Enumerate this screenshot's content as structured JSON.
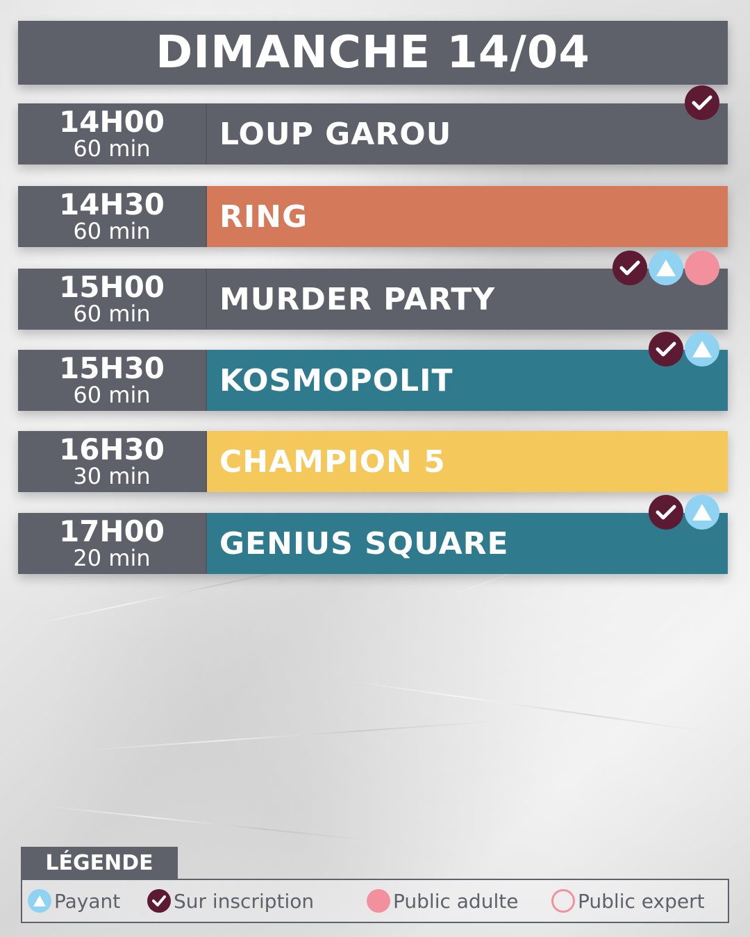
{
  "header": {
    "title": "DIMANCHE 14/04"
  },
  "colors": {
    "slate": "#5e616a",
    "orange": "#d4795a",
    "teal": "#2f7b8d",
    "yellow": "#f5c85c",
    "maroon": "#5c1b33",
    "light_blue": "#8fd2f2",
    "pink": "#f3909e"
  },
  "schedule": [
    {
      "time": "14H00",
      "duration": "60 min",
      "title": "LOUP GAROU",
      "color": "#5e616a",
      "badges": [
        "check-icon"
      ]
    },
    {
      "time": "14H30",
      "duration": "60 min",
      "title": "RING",
      "color": "#d4795a",
      "badges": []
    },
    {
      "time": "15H00",
      "duration": "60 min",
      "title": "MURDER PARTY",
      "color": "#5e616a",
      "badges": [
        "check-icon",
        "triangle-icon",
        "adult-dot-icon"
      ]
    },
    {
      "time": "15H30",
      "duration": "60 min",
      "title": "KOSMOPOLIT",
      "color": "#2f7b8d",
      "badges": [
        "check-icon",
        "triangle-icon"
      ]
    },
    {
      "time": "16H30",
      "duration": "30 min",
      "title": "CHAMPION 5",
      "color": "#f5c85c",
      "badges": []
    },
    {
      "time": "17H00",
      "duration": "20 min",
      "title": "GENIUS SQUARE",
      "color": "#2f7b8d",
      "badges": [
        "check-icon",
        "triangle-icon"
      ]
    }
  ],
  "legend": {
    "label": "LÉGENDE",
    "items": [
      {
        "icon": "triangle-icon",
        "text": "Payant"
      },
      {
        "icon": "check-icon",
        "text": "Sur inscription"
      },
      {
        "icon": "adult-dot-icon",
        "text": "Public adulte"
      },
      {
        "icon": "expert-ring-icon",
        "text": "Public expert"
      }
    ]
  }
}
